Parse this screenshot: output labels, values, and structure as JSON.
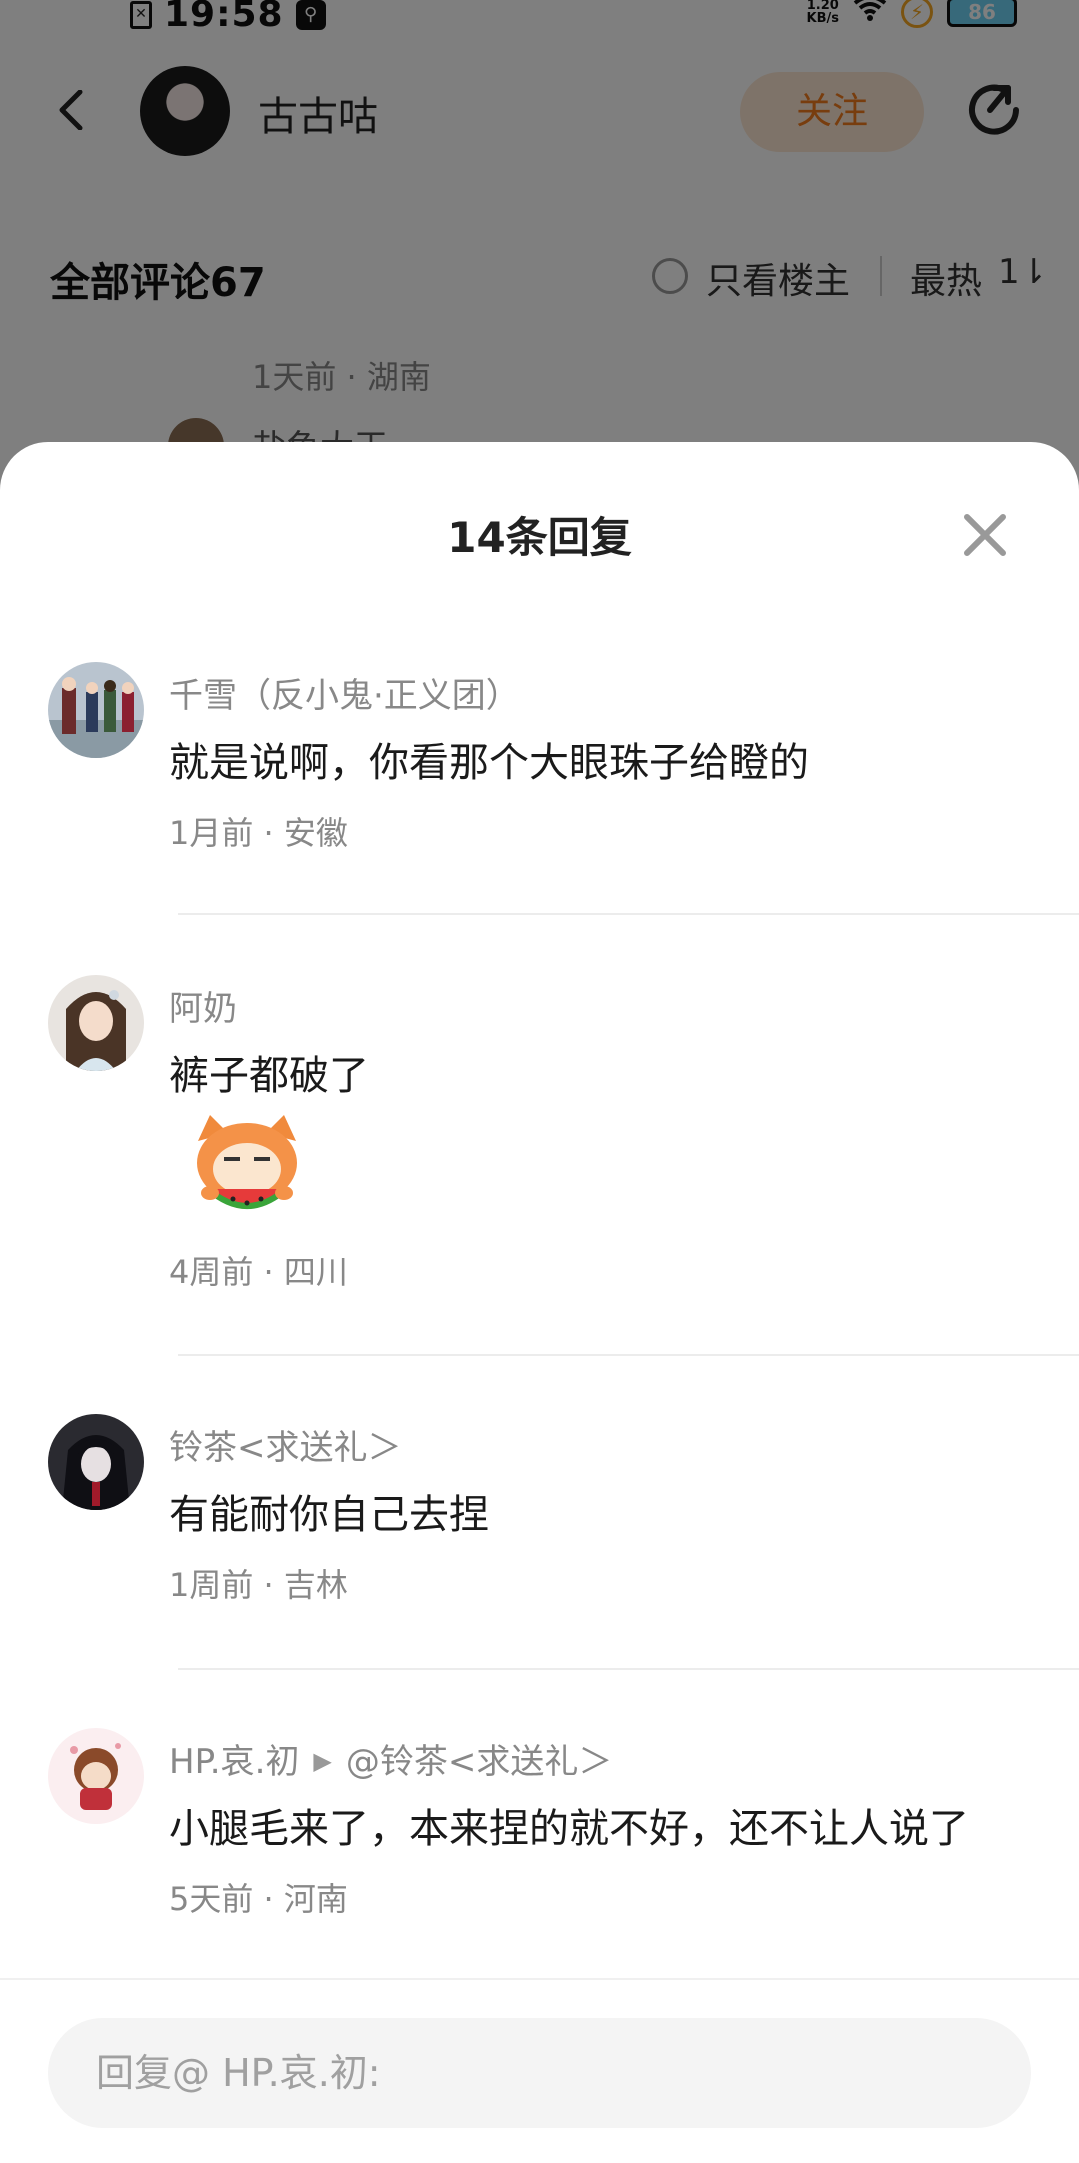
{
  "status_bar": {
    "time": "19:58",
    "net_speed_value": "1.20",
    "net_speed_unit": "KB/s",
    "battery": "86"
  },
  "post_header": {
    "author_name": "古古咕",
    "follow_label": "关注"
  },
  "comments_header": {
    "title": "全部评论67",
    "only_owner_label": "只看楼主",
    "sort_label": "最热",
    "sort_icon": "1⇂"
  },
  "background_comment": {
    "meta": "1天前 · 湖南",
    "reply_name": "盐鱼大王"
  },
  "sheet": {
    "title": "14条回复",
    "replies": [
      {
        "name": "千雪（反小鬼·正义团）",
        "content": "就是说啊，你看那个大眼珠子给瞪的",
        "meta": "1月前 · 安徽",
        "avatar_icon": "avatar-school-characters"
      },
      {
        "name": "阿奶",
        "content": "裤子都破了",
        "meta": "4周前 · 四川",
        "avatar_icon": "avatar-girl-bob",
        "sticker": "watermelon-cat-sticker"
      },
      {
        "name": "铃茶<求送礼＞",
        "content": "有能耐你自己去捏",
        "meta": "1周前 · 吉林",
        "avatar_icon": "avatar-dark-anime"
      },
      {
        "name": "HP.哀.初",
        "reply_to": "@铃茶<求送礼＞",
        "content": "小腿毛来了，本来捏的就不好，还不让人说了",
        "meta": "5天前 · 河南",
        "avatar_icon": "avatar-chibi-doll"
      }
    ],
    "reply_placeholder": "回复@ HP.哀.初:"
  },
  "colors": {
    "accent": "#f07b1c",
    "overlay": "rgba(0,0,0,0.5)",
    "muted_text": "#888888"
  }
}
